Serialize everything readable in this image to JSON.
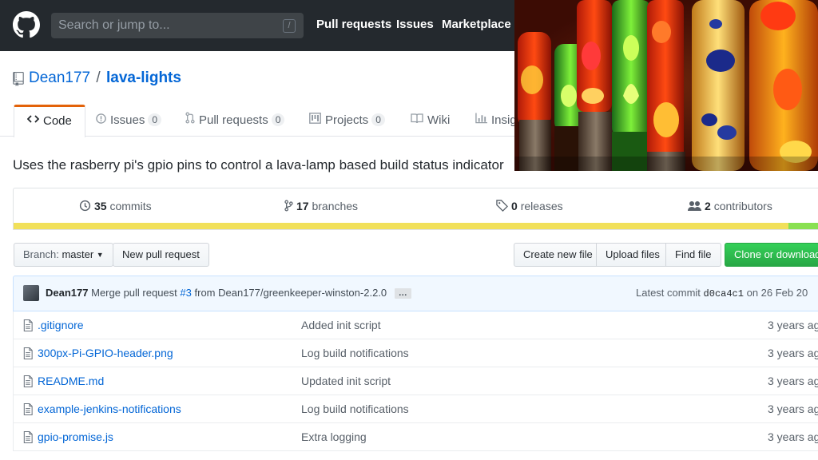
{
  "header": {
    "search_placeholder": "Search or jump to...",
    "search_key": "/",
    "nav": [
      "Pull requests",
      "Issues",
      "Marketplace"
    ]
  },
  "repo": {
    "owner": "Dean177",
    "separator": "/",
    "name": "lava-lights",
    "description": "Uses the rasberry pi's gpio pins to control a lava-lamp based build status indicator"
  },
  "tabs": [
    {
      "label": "Code",
      "icon": "code-icon",
      "active": true
    },
    {
      "label": "Issues",
      "count": "0",
      "icon": "issue-icon"
    },
    {
      "label": "Pull requests",
      "count": "0",
      "icon": "pull-request-icon"
    },
    {
      "label": "Projects",
      "count": "0",
      "icon": "project-icon"
    },
    {
      "label": "Wiki",
      "icon": "book-icon"
    },
    {
      "label": "Insig",
      "icon": "graph-icon"
    }
  ],
  "summary": {
    "commits_count": "35",
    "commits_label": "commits",
    "branches_count": "17",
    "branches_label": "branches",
    "releases_count": "0",
    "releases_label": "releases",
    "contributors_count": "2",
    "contributors_label": "contributors"
  },
  "language_bar": [
    {
      "color": "#f1e05a",
      "fraction": 0.96
    },
    {
      "color": "#89e051",
      "fraction": 0.04
    }
  ],
  "toolbar": {
    "branch_prefix": "Branch:",
    "branch_name": "master",
    "new_pr": "New pull request",
    "create_file": "Create new file",
    "upload_files": "Upload files",
    "find_file": "Find file",
    "clone": "Clone or download"
  },
  "commit": {
    "author": "Dean177",
    "message_prefix": "Merge pull request",
    "pr_link": "#3",
    "message_suffix": "from Dean177/greenkeeper-winston-2.2.0",
    "ellipsis": "…",
    "latest_label": "Latest commit",
    "sha": "d0ca4c1",
    "date": "on 26 Feb 20"
  },
  "files": [
    {
      "name": ".gitignore",
      "message": "Added init script",
      "age": "3 years ag"
    },
    {
      "name": "300px-Pi-GPIO-header.png",
      "message": "Log build notifications",
      "age": "3 years ag"
    },
    {
      "name": "README.md",
      "message": "Updated init script",
      "age": "3 years ag"
    },
    {
      "name": "example-jenkins-notifications",
      "message": "Log build notifications",
      "age": "3 years ag"
    },
    {
      "name": "gpio-promise.js",
      "message": "Extra logging",
      "age": "3 years ag"
    }
  ]
}
